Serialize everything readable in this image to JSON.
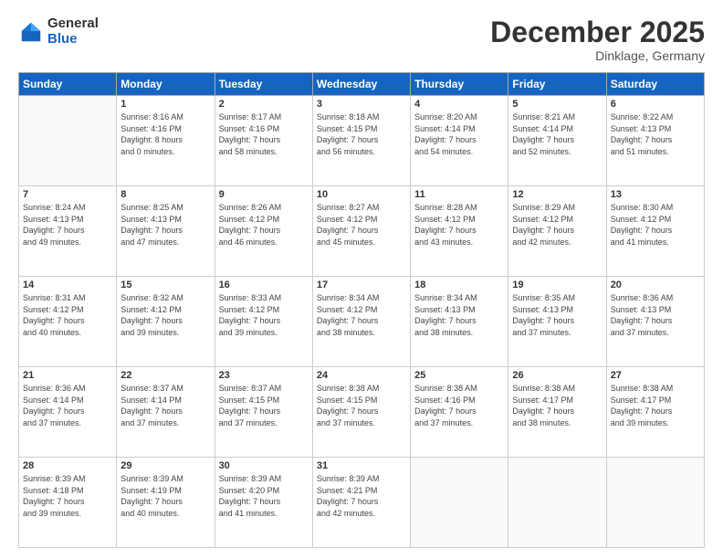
{
  "logo": {
    "general": "General",
    "blue": "Blue"
  },
  "header": {
    "month": "December 2025",
    "location": "Dinklage, Germany"
  },
  "days": [
    "Sunday",
    "Monday",
    "Tuesday",
    "Wednesday",
    "Thursday",
    "Friday",
    "Saturday"
  ],
  "weeks": [
    [
      {
        "num": "",
        "info": ""
      },
      {
        "num": "1",
        "info": "Sunrise: 8:16 AM\nSunset: 4:16 PM\nDaylight: 8 hours\nand 0 minutes."
      },
      {
        "num": "2",
        "info": "Sunrise: 8:17 AM\nSunset: 4:16 PM\nDaylight: 7 hours\nand 58 minutes."
      },
      {
        "num": "3",
        "info": "Sunrise: 8:18 AM\nSunset: 4:15 PM\nDaylight: 7 hours\nand 56 minutes."
      },
      {
        "num": "4",
        "info": "Sunrise: 8:20 AM\nSunset: 4:14 PM\nDaylight: 7 hours\nand 54 minutes."
      },
      {
        "num": "5",
        "info": "Sunrise: 8:21 AM\nSunset: 4:14 PM\nDaylight: 7 hours\nand 52 minutes."
      },
      {
        "num": "6",
        "info": "Sunrise: 8:22 AM\nSunset: 4:13 PM\nDaylight: 7 hours\nand 51 minutes."
      }
    ],
    [
      {
        "num": "7",
        "info": "Sunrise: 8:24 AM\nSunset: 4:13 PM\nDaylight: 7 hours\nand 49 minutes."
      },
      {
        "num": "8",
        "info": "Sunrise: 8:25 AM\nSunset: 4:13 PM\nDaylight: 7 hours\nand 47 minutes."
      },
      {
        "num": "9",
        "info": "Sunrise: 8:26 AM\nSunset: 4:12 PM\nDaylight: 7 hours\nand 46 minutes."
      },
      {
        "num": "10",
        "info": "Sunrise: 8:27 AM\nSunset: 4:12 PM\nDaylight: 7 hours\nand 45 minutes."
      },
      {
        "num": "11",
        "info": "Sunrise: 8:28 AM\nSunset: 4:12 PM\nDaylight: 7 hours\nand 43 minutes."
      },
      {
        "num": "12",
        "info": "Sunrise: 8:29 AM\nSunset: 4:12 PM\nDaylight: 7 hours\nand 42 minutes."
      },
      {
        "num": "13",
        "info": "Sunrise: 8:30 AM\nSunset: 4:12 PM\nDaylight: 7 hours\nand 41 minutes."
      }
    ],
    [
      {
        "num": "14",
        "info": "Sunrise: 8:31 AM\nSunset: 4:12 PM\nDaylight: 7 hours\nand 40 minutes."
      },
      {
        "num": "15",
        "info": "Sunrise: 8:32 AM\nSunset: 4:12 PM\nDaylight: 7 hours\nand 39 minutes."
      },
      {
        "num": "16",
        "info": "Sunrise: 8:33 AM\nSunset: 4:12 PM\nDaylight: 7 hours\nand 39 minutes."
      },
      {
        "num": "17",
        "info": "Sunrise: 8:34 AM\nSunset: 4:12 PM\nDaylight: 7 hours\nand 38 minutes."
      },
      {
        "num": "18",
        "info": "Sunrise: 8:34 AM\nSunset: 4:13 PM\nDaylight: 7 hours\nand 38 minutes."
      },
      {
        "num": "19",
        "info": "Sunrise: 8:35 AM\nSunset: 4:13 PM\nDaylight: 7 hours\nand 37 minutes."
      },
      {
        "num": "20",
        "info": "Sunrise: 8:36 AM\nSunset: 4:13 PM\nDaylight: 7 hours\nand 37 minutes."
      }
    ],
    [
      {
        "num": "21",
        "info": "Sunrise: 8:36 AM\nSunset: 4:14 PM\nDaylight: 7 hours\nand 37 minutes."
      },
      {
        "num": "22",
        "info": "Sunrise: 8:37 AM\nSunset: 4:14 PM\nDaylight: 7 hours\nand 37 minutes."
      },
      {
        "num": "23",
        "info": "Sunrise: 8:37 AM\nSunset: 4:15 PM\nDaylight: 7 hours\nand 37 minutes."
      },
      {
        "num": "24",
        "info": "Sunrise: 8:38 AM\nSunset: 4:15 PM\nDaylight: 7 hours\nand 37 minutes."
      },
      {
        "num": "25",
        "info": "Sunrise: 8:38 AM\nSunset: 4:16 PM\nDaylight: 7 hours\nand 37 minutes."
      },
      {
        "num": "26",
        "info": "Sunrise: 8:38 AM\nSunset: 4:17 PM\nDaylight: 7 hours\nand 38 minutes."
      },
      {
        "num": "27",
        "info": "Sunrise: 8:38 AM\nSunset: 4:17 PM\nDaylight: 7 hours\nand 39 minutes."
      }
    ],
    [
      {
        "num": "28",
        "info": "Sunrise: 8:39 AM\nSunset: 4:18 PM\nDaylight: 7 hours\nand 39 minutes."
      },
      {
        "num": "29",
        "info": "Sunrise: 8:39 AM\nSunset: 4:19 PM\nDaylight: 7 hours\nand 40 minutes."
      },
      {
        "num": "30",
        "info": "Sunrise: 8:39 AM\nSunset: 4:20 PM\nDaylight: 7 hours\nand 41 minutes."
      },
      {
        "num": "31",
        "info": "Sunrise: 8:39 AM\nSunset: 4:21 PM\nDaylight: 7 hours\nand 42 minutes."
      },
      {
        "num": "",
        "info": ""
      },
      {
        "num": "",
        "info": ""
      },
      {
        "num": "",
        "info": ""
      }
    ]
  ]
}
